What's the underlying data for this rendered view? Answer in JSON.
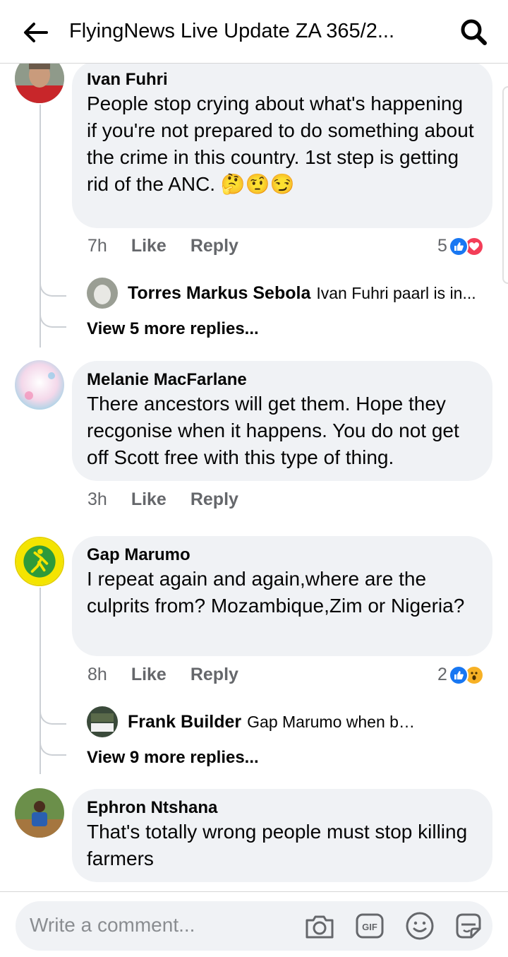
{
  "header": {
    "title": "FlyingNews Live Update ZA 365/2..."
  },
  "comments": [
    {
      "author": "Ivan Fuhri",
      "text": "People stop crying about what's happening if you're not prepared to do something about the crime in this country. 1st step is getting rid of the ANC. 🤔🤨😏",
      "time": "7h",
      "like": "Like",
      "reply": "Reply",
      "reaction_count": "5",
      "reply_preview": {
        "name": "Torres Markus Sebola",
        "text": "Ivan Fuhri paarl is in..."
      },
      "more_replies": "View 5 more replies..."
    },
    {
      "author": "Melanie MacFarlane",
      "text": "There ancestors will get them. Hope they recgonise  when it happens. You do not get off Scott free with this type of thing.",
      "time": "3h",
      "like": "Like",
      "reply": "Reply"
    },
    {
      "author": "Gap Marumo",
      "text": "I repeat again and again,where are the culprits from? Mozambique,Zim or Nigeria?",
      "time": "8h",
      "like": "Like",
      "reply": "Reply",
      "reaction_count": "2",
      "reply_preview": {
        "name": "Frank Builder",
        "text": "Gap Marumo when bob Marl..."
      },
      "more_replies": "View 9 more replies..."
    },
    {
      "author": "Ephron Ntshana",
      "text": "That's totally wrong people must stop killing farmers"
    }
  ],
  "composer": {
    "placeholder": "Write a comment..."
  },
  "colors": {
    "like_blue": "#1877f2",
    "love_red": "#f33e58",
    "wow_yellow": "#f7b125",
    "bubble": "#f0f2f5"
  },
  "icons": [
    "back-arrow-icon",
    "search-icon",
    "camera-icon",
    "gif-icon",
    "emoji-icon",
    "sticker-icon",
    "like-reaction-icon",
    "love-reaction-icon",
    "wow-reaction-icon"
  ]
}
